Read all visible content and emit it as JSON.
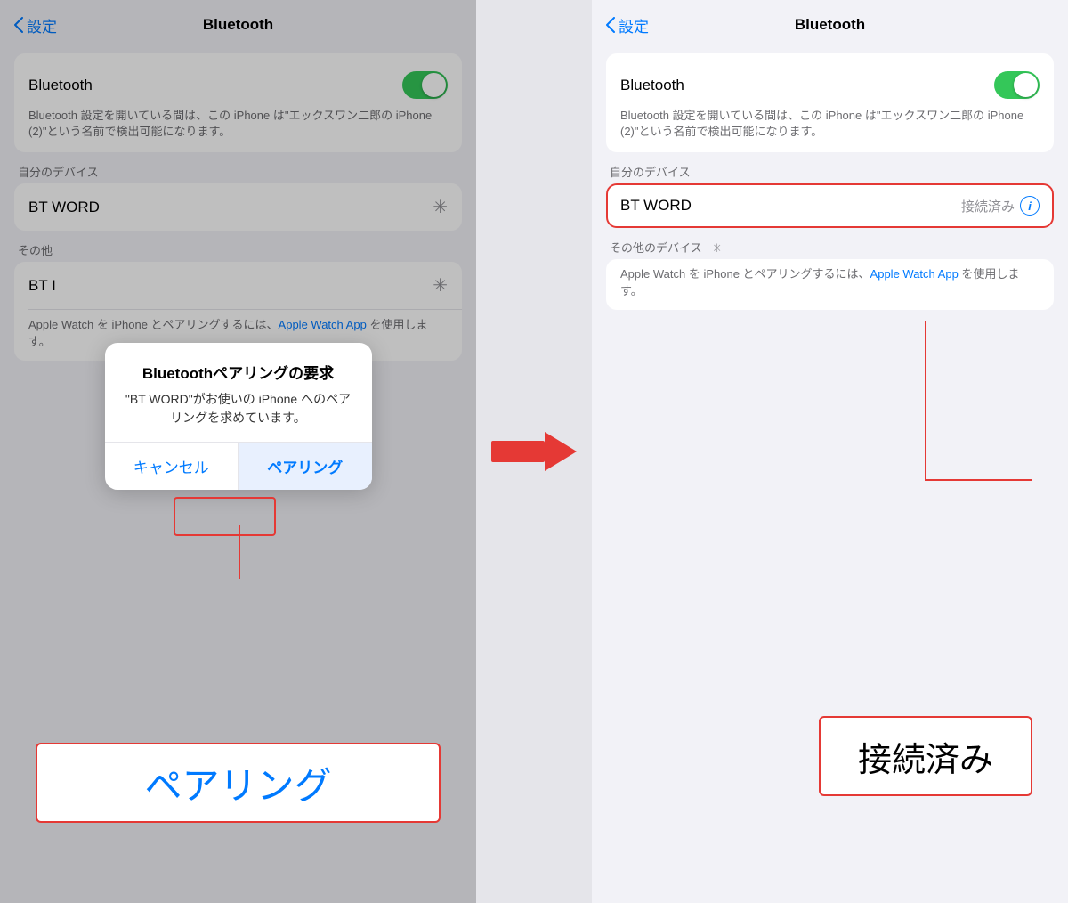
{
  "left_panel": {
    "nav_back_label": "設定",
    "nav_title": "Bluetooth",
    "bluetooth_toggle_label": "Bluetooth",
    "bluetooth_desc": "Bluetooth 設定を開いている間は、この iPhone は\"エックスワン二郎の iPhone (2)\"という名前で検出可能になります。",
    "my_devices_header": "自分のデバイス",
    "bt_word_label": "BT WORD",
    "other_devices_header": "その他",
    "bt_other_label": "BT I",
    "apple_watch_desc": "Apple Watch を iPhone とペアリングするには、",
    "apple_watch_link": "Apple Watch App",
    "apple_watch_desc2": "を使用します。"
  },
  "dialog": {
    "title": "Bluetoothペアリングの要求",
    "message": "\"BT WORD\"がお使いの iPhone へのペアリングを求めています。",
    "cancel_label": "キャンセル",
    "confirm_label": "ペアリング"
  },
  "big_label_left": "ペアリング",
  "right_panel": {
    "nav_back_label": "設定",
    "nav_title": "Bluetooth",
    "bluetooth_toggle_label": "Bluetooth",
    "bluetooth_desc": "Bluetooth 設定を開いている間は、この iPhone は\"エックスワン二郎の iPhone (2)\"という名前で検出可能になります。",
    "my_devices_header": "自分のデバイス",
    "bt_word_label": "BT WORD",
    "connected_label": "接続済み",
    "other_devices_header": "その他のデバイス",
    "apple_watch_desc": "Apple Watch を iPhone とペアリングするには、",
    "apple_watch_link": "Apple Watch App",
    "apple_watch_desc2": "を使用します。"
  },
  "big_label_right": "接続済み",
  "icons": {
    "chevron_left": "‹",
    "info": "i",
    "spinner": "✳"
  }
}
